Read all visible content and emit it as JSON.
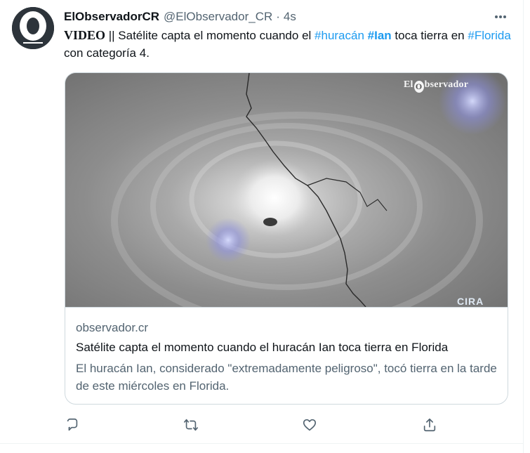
{
  "account": {
    "display_name": "ElObservadorCR",
    "handle": "@ElObservador_CR",
    "separator": "·",
    "time_ago": "4s"
  },
  "tweet": {
    "lead": "VIDEO",
    "segment_1": " || Satélite capta el momento cuando el ",
    "hashtag_1": "#huracán",
    "hashtag_2": "#Ian",
    "segment_2": " toca tierra en ",
    "hashtag_3": "#Florida",
    "segment_3": " con categoría 4."
  },
  "card": {
    "domain": "observador.cr",
    "title": "Satélite capta el momento cuando el huracán Ian toca tierra en Florida",
    "description": "El huracán Ian, considerado \"extremadamente peligroso\", tocó tierra en la tarde de este miércoles en Florida.",
    "watermark_left": "El",
    "watermark_o": "O",
    "watermark_right": "bservador",
    "corner_mark": "CIRA"
  },
  "actions": [
    "reply-icon",
    "retweet-icon",
    "like-icon",
    "share-icon"
  ],
  "colors": {
    "link": "#1d9bf0",
    "text": "#0f1419",
    "secondary": "#536471",
    "border": "#cfd9de"
  }
}
